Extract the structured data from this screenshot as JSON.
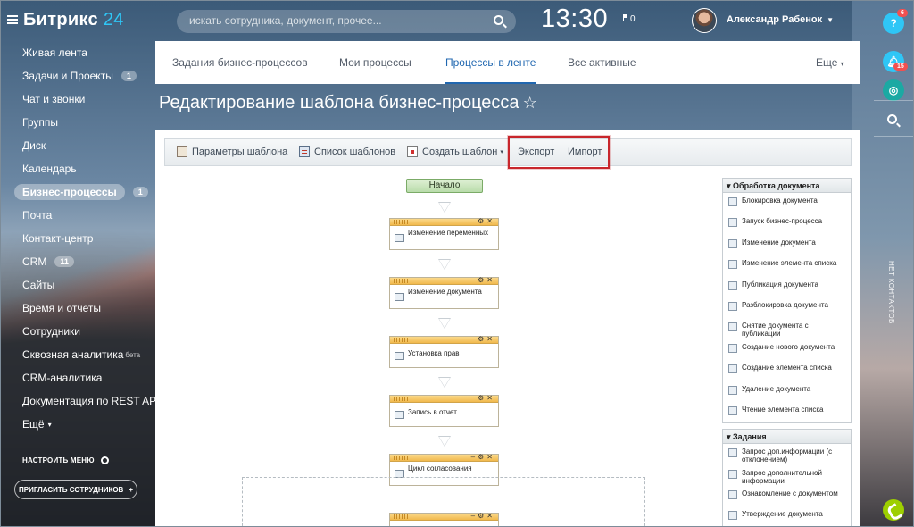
{
  "app": {
    "logo_name": "Битрикс",
    "logo_number": "24"
  },
  "header": {
    "search_placeholder": "искать сотрудника, документ, прочее...",
    "clock": "13:30",
    "flag_count": "0",
    "user_name": "Александр Рабенок"
  },
  "sidebar": {
    "items": [
      {
        "label": "Живая лента"
      },
      {
        "label": "Задачи и Проекты",
        "badge": "1"
      },
      {
        "label": "Чат и звонки"
      },
      {
        "label": "Группы"
      },
      {
        "label": "Диск"
      },
      {
        "label": "Календарь"
      },
      {
        "label": "Бизнес-процессы",
        "badge": "1"
      },
      {
        "label": "Почта"
      },
      {
        "label": "Контакт-центр"
      },
      {
        "label": "CRM",
        "badge": "11"
      },
      {
        "label": "Сайты"
      },
      {
        "label": "Время и отчеты"
      },
      {
        "label": "Сотрудники"
      },
      {
        "label": "Сквозная аналитика",
        "sup": "бета"
      },
      {
        "label": "CRM-аналитика"
      },
      {
        "label": "Документация по REST API"
      },
      {
        "label": "Ещё"
      }
    ],
    "settings": "НАСТРОИТЬ МЕНЮ",
    "invite": "ПРИГЛАСИТЬ СОТРУДНИКОВ"
  },
  "tabs": {
    "items": [
      "Задания бизнес-процессов",
      "Мои процессы",
      "Процессы в ленте",
      "Все активные"
    ],
    "active": "Процессы в ленте",
    "more": "Еще"
  },
  "page": {
    "title": "Редактирование шаблона бизнес-процесса"
  },
  "toolbar": {
    "params": "Параметры шаблона",
    "list": "Список шаблонов",
    "create": "Создать шаблон",
    "export": "Экспорт",
    "import": "Импорт"
  },
  "workflow": {
    "start": "Начало",
    "activities": [
      "Изменение переменных",
      "Изменение документа",
      "Установка прав",
      "Запись в отчет",
      "Цикл согласования"
    ]
  },
  "palette": {
    "groups": [
      {
        "title": "Обработка документа",
        "items": [
          "Блокировка документа",
          "Запуск бизнес-процесса",
          "Изменение документа",
          "Изменение элемента списка",
          "Публикация документа",
          "Разблокировка документа",
          "Снятие документа с публикации",
          "Создание нового документа",
          "Создание элемента списка",
          "Удаление документа",
          "Чтение элемента списка"
        ]
      },
      {
        "title": "Задания",
        "items": [
          "Запрос доп.информации (с отклонением)",
          "Запрос дополнительной информации",
          "Ознакомление с документом",
          "Утверждение документа"
        ]
      }
    ]
  },
  "rail": {
    "help_count": "6",
    "notify_count": "15",
    "vertical_label": "НЕТ КОНТАКТОВ"
  },
  "colors": {
    "accent": "#2fc6f6",
    "active_tab": "#2067b0",
    "highlight": "#c8262c",
    "phone": "#9dcf00"
  }
}
